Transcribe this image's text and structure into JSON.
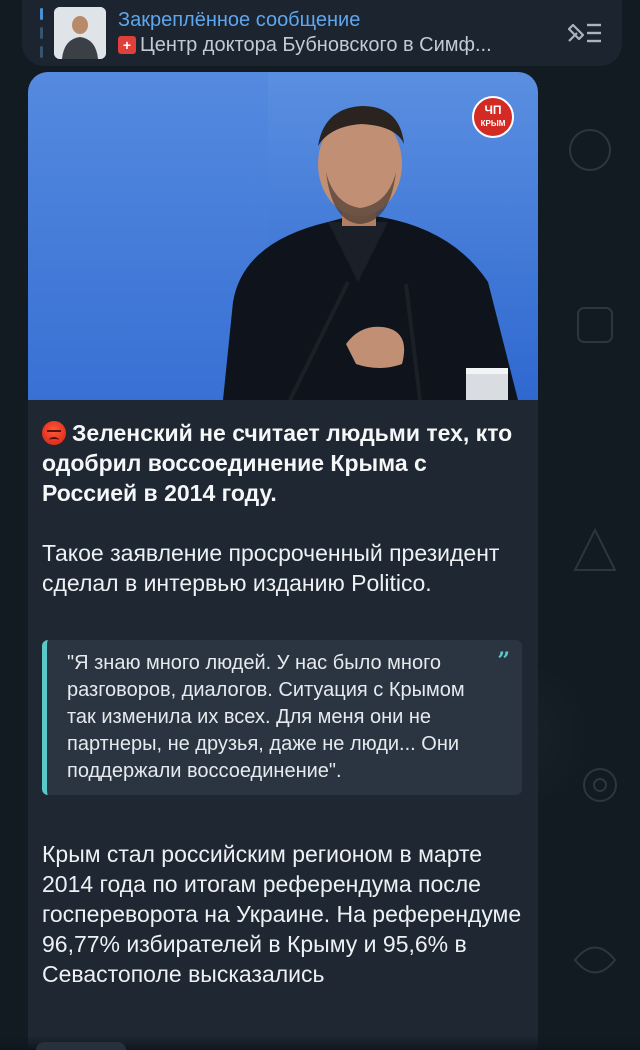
{
  "pinned": {
    "title": "Закреплённое сообщение",
    "subtitle": "Центр доктора Бубновского в Симф...",
    "colors": {
      "title": "#5ea6ee",
      "accent": "#4a90d9"
    },
    "icons": {
      "badge": "red-cross-icon",
      "list": "pinned-list-icon"
    }
  },
  "message": {
    "photo": {
      "channel_logo_line1": "ЧП",
      "channel_logo_line2": "КРЫМ"
    },
    "headline": "Зеленский не считает людьми тех, кто одобрил воссоединение Крыма с Россией в 2014 году.",
    "headline_emoji": "angry-face-icon",
    "paragraph1": "Такое заявление просроченный президент сделал в интервью изданию Politico.",
    "quote": "\"Я знаю много людей. У нас было много разговоров, диалогов. Ситуация с Крымом так изменила их всех. Для меня они не партнеры, не друзья, даже не люди... Они поддержали воссоединение\".",
    "quote_mark": "”",
    "paragraph2": "Крым стал российским регионом в марте 2014 года по итогам референдума после госпереворота на Украине. На референдуме 96,77% избирателей в Крыму и 95,6% в Севастополе высказались"
  }
}
